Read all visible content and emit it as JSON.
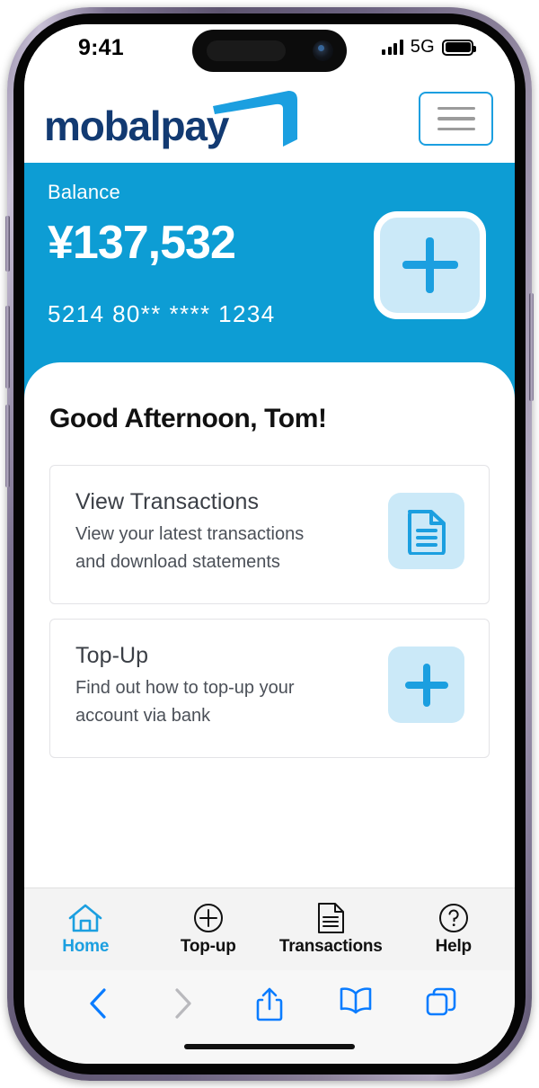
{
  "status_bar": {
    "time": "9:41",
    "network": "5G",
    "signal_icon": "cellular-signal-icon",
    "battery_icon": "battery-full-icon"
  },
  "app_header": {
    "logo_text": "mobalpay",
    "logo_icon": "mobalpay-card-swoosh-icon",
    "menu_icon": "hamburger-menu-icon"
  },
  "balance": {
    "label": "Balance",
    "amount": "¥137,532",
    "card_number": "5214 80** **** 1234",
    "topup_icon": "plus-icon",
    "accent_color": "#0d9dd4",
    "icon_bg_color": "#cbe9f8"
  },
  "main": {
    "greeting": "Good Afternoon, Tom!",
    "cards": [
      {
        "title": "View Transactions",
        "description": "View your latest transactions and download statements",
        "icon": "document-icon"
      },
      {
        "title": "Top-Up",
        "description": "Find out how to top-up your account via bank",
        "icon": "plus-icon"
      }
    ]
  },
  "bottom_nav": {
    "active_color": "#1b9fe0",
    "items": [
      {
        "label": "Home",
        "icon": "home-icon",
        "active": true
      },
      {
        "label": "Top-up",
        "icon": "plus-circle-icon",
        "active": false
      },
      {
        "label": "Transactions",
        "icon": "document-icon",
        "active": false
      },
      {
        "label": "Help",
        "icon": "question-circle-icon",
        "active": false
      }
    ]
  },
  "browser_toolbar": {
    "items": [
      {
        "name": "back",
        "icon": "chevron-left-icon",
        "enabled": true
      },
      {
        "name": "forward",
        "icon": "chevron-right-icon",
        "enabled": false
      },
      {
        "name": "share",
        "icon": "share-icon",
        "enabled": true
      },
      {
        "name": "bookmarks",
        "icon": "book-icon",
        "enabled": true
      },
      {
        "name": "tabs",
        "icon": "tabs-icon",
        "enabled": true
      }
    ]
  }
}
